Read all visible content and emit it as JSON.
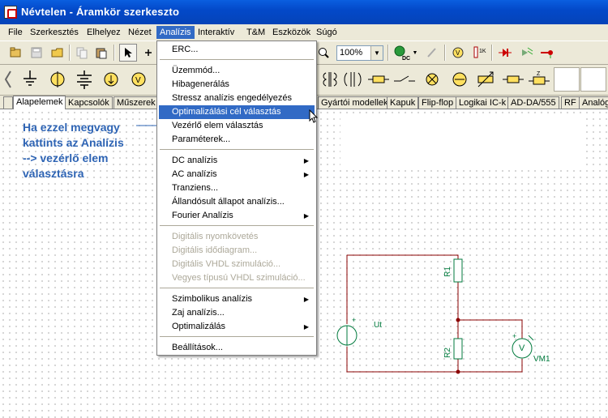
{
  "window": {
    "title": "Névtelen - Áramkör szerkeszto"
  },
  "menubar": [
    {
      "label": "File"
    },
    {
      "label": "Szerkesztés"
    },
    {
      "label": "Elhelyez"
    },
    {
      "label": "Nézet"
    },
    {
      "label": "Analízis"
    },
    {
      "label": "Interaktív"
    },
    {
      "label": "T&M"
    },
    {
      "label": "Eszközök"
    },
    {
      "label": "Súgó"
    }
  ],
  "toolbar": {
    "zoom_value": "100%"
  },
  "tabs": [
    "Alapelemek",
    "Kapcsolók",
    "Műszerek",
    "Gyártói modellek",
    "Kapuk",
    "Flip-flop",
    "Logikai IC-k",
    "AD-DA/555",
    "RF",
    "Analóg"
  ],
  "analysis_menu": {
    "items": [
      {
        "label": "ERC..."
      },
      {
        "label": "Üzemmód..."
      },
      {
        "label": "Hibagenerálás"
      },
      {
        "label": "Stressz analízis engedélyezés"
      },
      {
        "label": "Optimalizálási cél választás"
      },
      {
        "label": "Vezérlő elem választás"
      },
      {
        "label": "Paraméterek..."
      },
      {
        "label": "DC analízis"
      },
      {
        "label": "AC analízis"
      },
      {
        "label": "Tranziens..."
      },
      {
        "label": "Állandósult állapot analízis..."
      },
      {
        "label": "Fourier Analízis"
      },
      {
        "label": "Digitális nyomkövetés"
      },
      {
        "label": "Digitális idődiagram..."
      },
      {
        "label": "Digitális VHDL szimuláció..."
      },
      {
        "label": "Vegyes típusú VHDL szimuláció..."
      },
      {
        "label": "Szimbolikus analízis"
      },
      {
        "label": "Zaj analízis..."
      },
      {
        "label": "Optimalizálás"
      },
      {
        "label": "Beállítások..."
      }
    ]
  },
  "annotation": {
    "text": "Ha ezzel megvagy\nkattints az Analízis\n--> vezérlő elem\nválasztásra"
  },
  "circuit": {
    "labels": {
      "r1": "R1",
      "r2": "R2",
      "source": "Ut",
      "meter": "VM1",
      "meter_symbol": "V",
      "plus": "+"
    }
  },
  "colors": {
    "accent": "#316ac5",
    "annotation": "#2e64b4",
    "wire": "#8b0000",
    "component": "#007a3d"
  }
}
